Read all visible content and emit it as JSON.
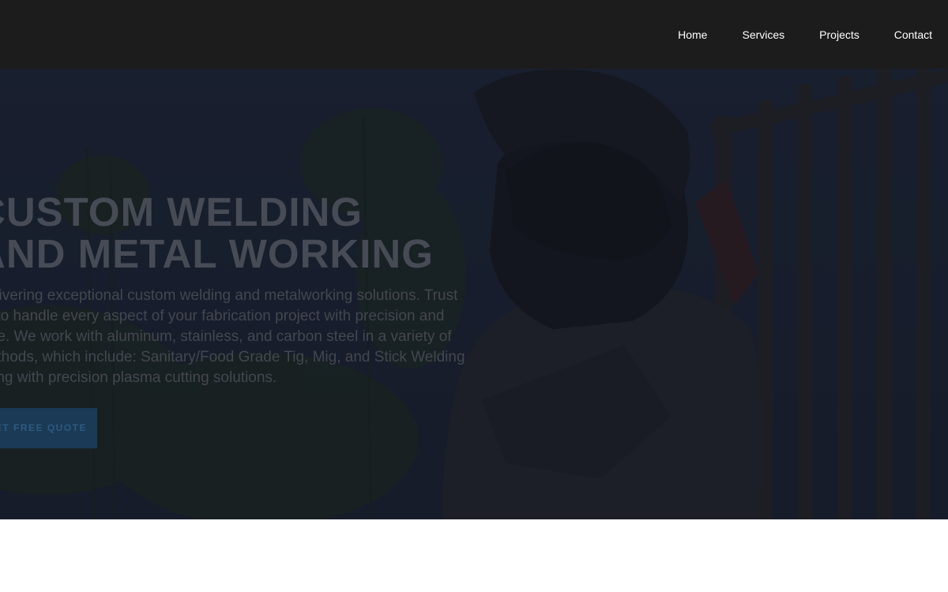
{
  "nav": {
    "links": [
      "Home",
      "Services",
      "Projects",
      "Contact"
    ]
  },
  "hero": {
    "title_lines": [
      "CUSTOM WELDING",
      "AND METAL WORKING"
    ],
    "description": "Delivering exceptional custom welding and metalworking solutions. Trust us to handle every aspect of your fabrication project with precision and care. We work with aluminum, stainless, and carbon steel in a variety of methods, which include: Sanitary/Food Grade Tig, Mig, and Stick Welding along with precision plasma cutting solutions.",
    "cta_label": "GET FREE QUOTE"
  },
  "colors": {
    "nav_bg": "#1c1c1c",
    "hero_overlay": "#12161f",
    "accent": "#1b3a55"
  }
}
